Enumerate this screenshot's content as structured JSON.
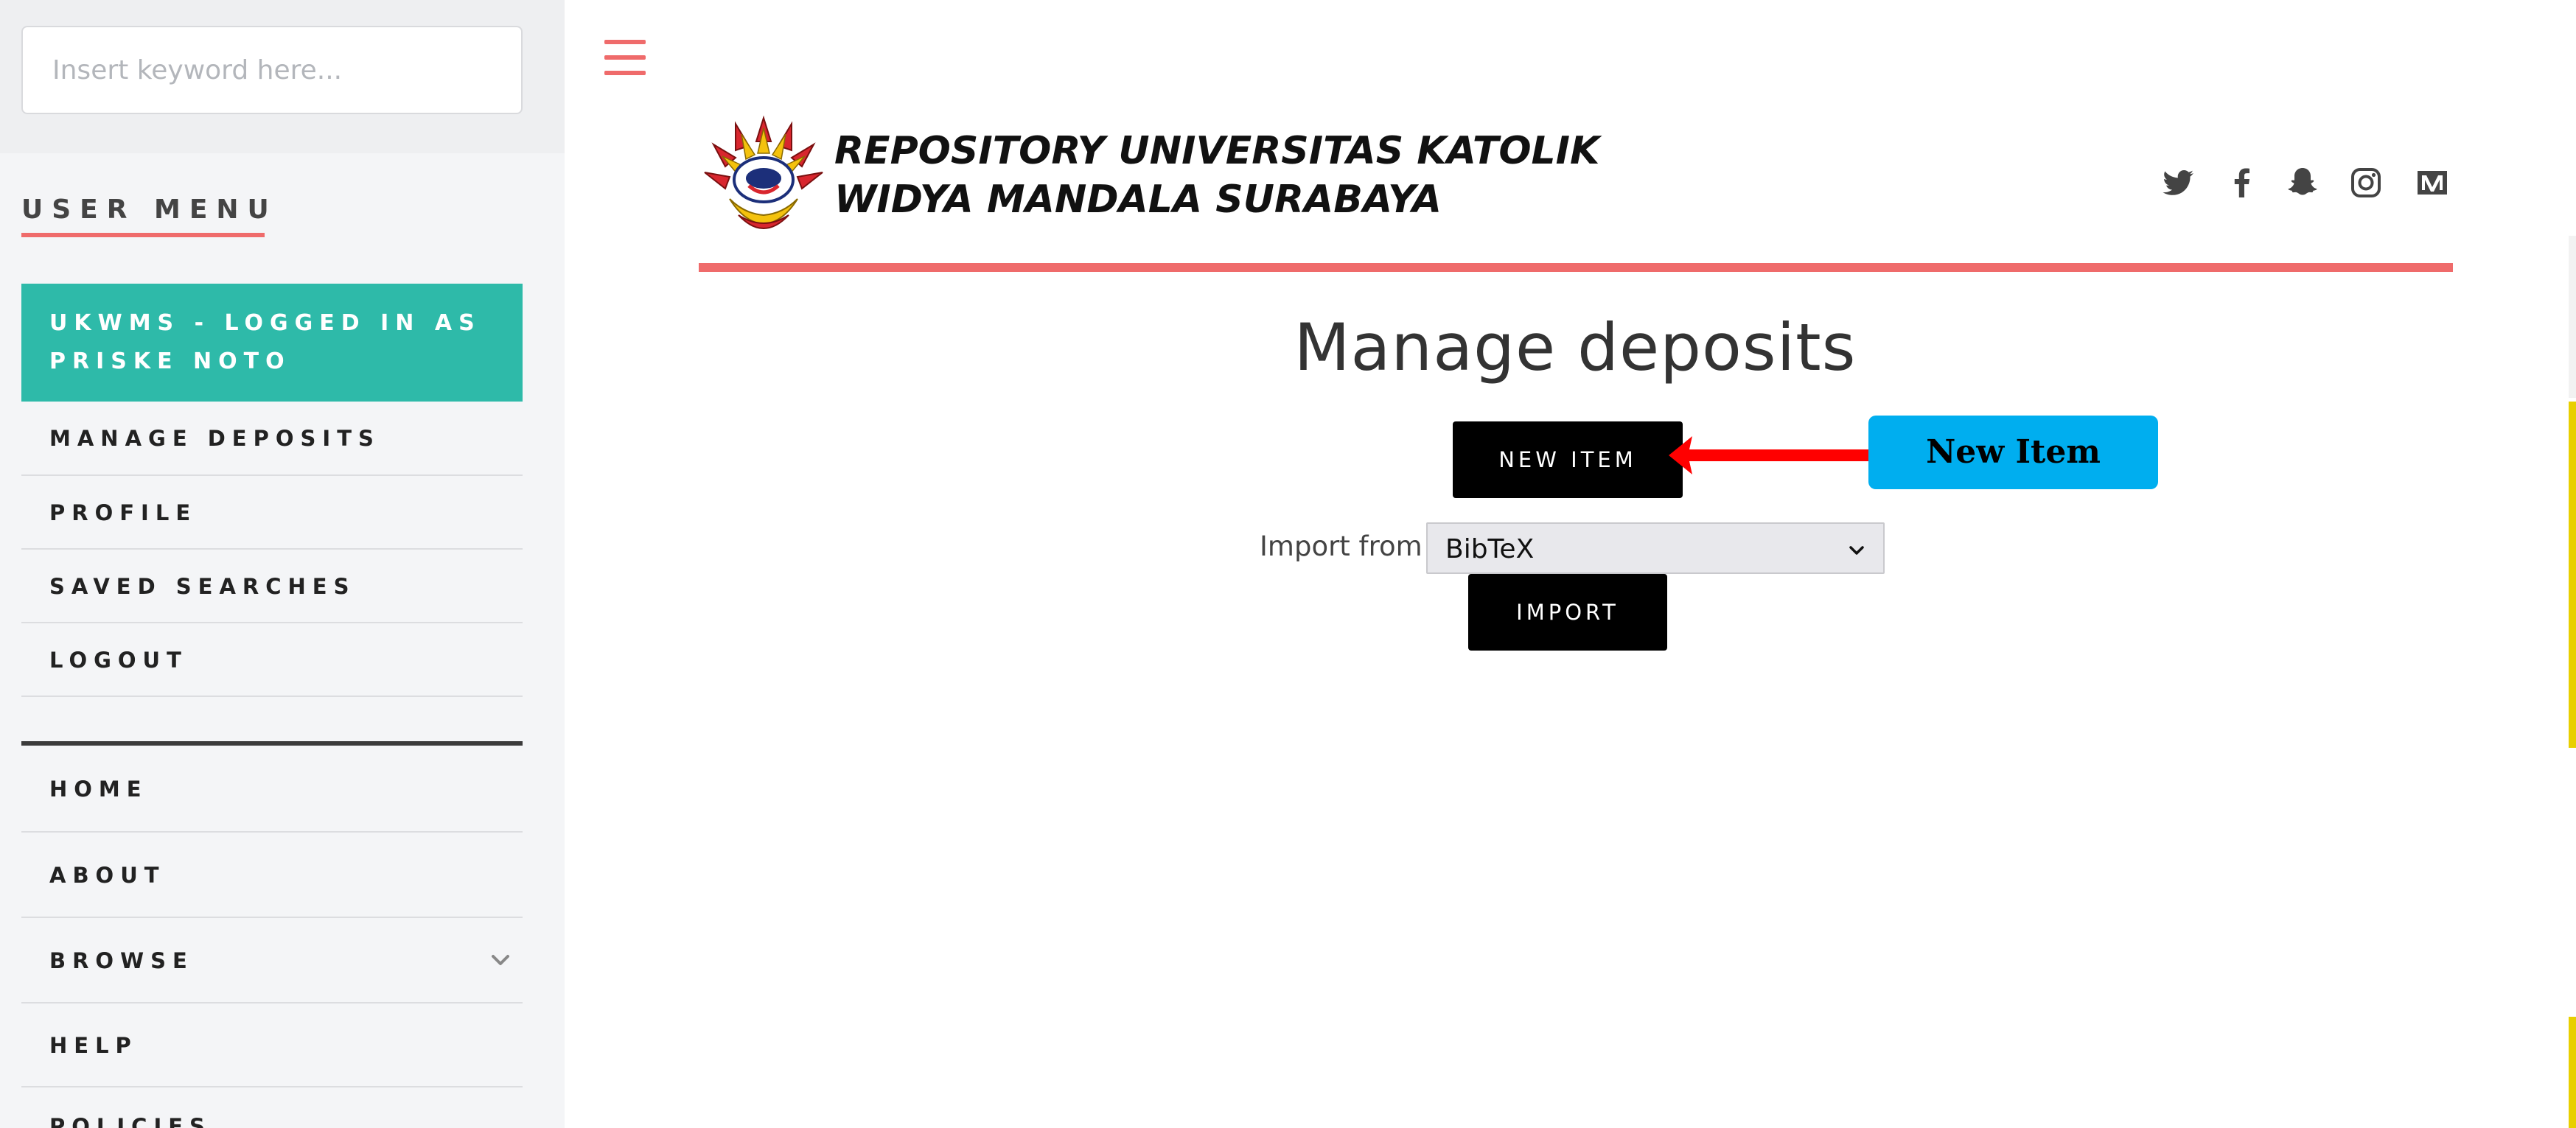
{
  "search": {
    "placeholder": "Insert keyword here..."
  },
  "user_menu": {
    "title": "USER MENU",
    "logged_in_line1": "UKWMS - LOGGED IN AS",
    "logged_in_line2": "PRISKE NOTO",
    "items": [
      {
        "label": "MANAGE DEPOSITS"
      },
      {
        "label": "PROFILE"
      },
      {
        "label": "SAVED SEARCHES"
      },
      {
        "label": "LOGOUT"
      }
    ]
  },
  "main_menu": {
    "items": [
      {
        "label": "HOME"
      },
      {
        "label": "ABOUT"
      },
      {
        "label": "BROWSE",
        "has_submenu": true
      },
      {
        "label": "HELP"
      },
      {
        "label": "POLICIES"
      }
    ]
  },
  "header": {
    "site_title_line1": "REPOSITORY UNIVERSITAS KATOLIK",
    "site_title_line2": "WIDYA MANDALA SURABAYA",
    "social_icons": [
      "twitter-icon",
      "facebook-icon",
      "snapchat-icon",
      "instagram-icon",
      "medium-icon"
    ],
    "accent_color": "#ef6b6b"
  },
  "main": {
    "page_title": "Manage deposits",
    "new_item_label": "NEW ITEM",
    "import_label": "Import from",
    "import_selected": "BibTeX",
    "import_button_label": "IMPORT"
  },
  "annotation": {
    "callout_text": "New Item",
    "callout_color": "#00aeef",
    "arrow_color": "#ff0000"
  },
  "colors": {
    "logged_in_bg": "#2ebaa9",
    "sidebar_bg": "#f4f5f7",
    "button_bg": "#000000"
  }
}
